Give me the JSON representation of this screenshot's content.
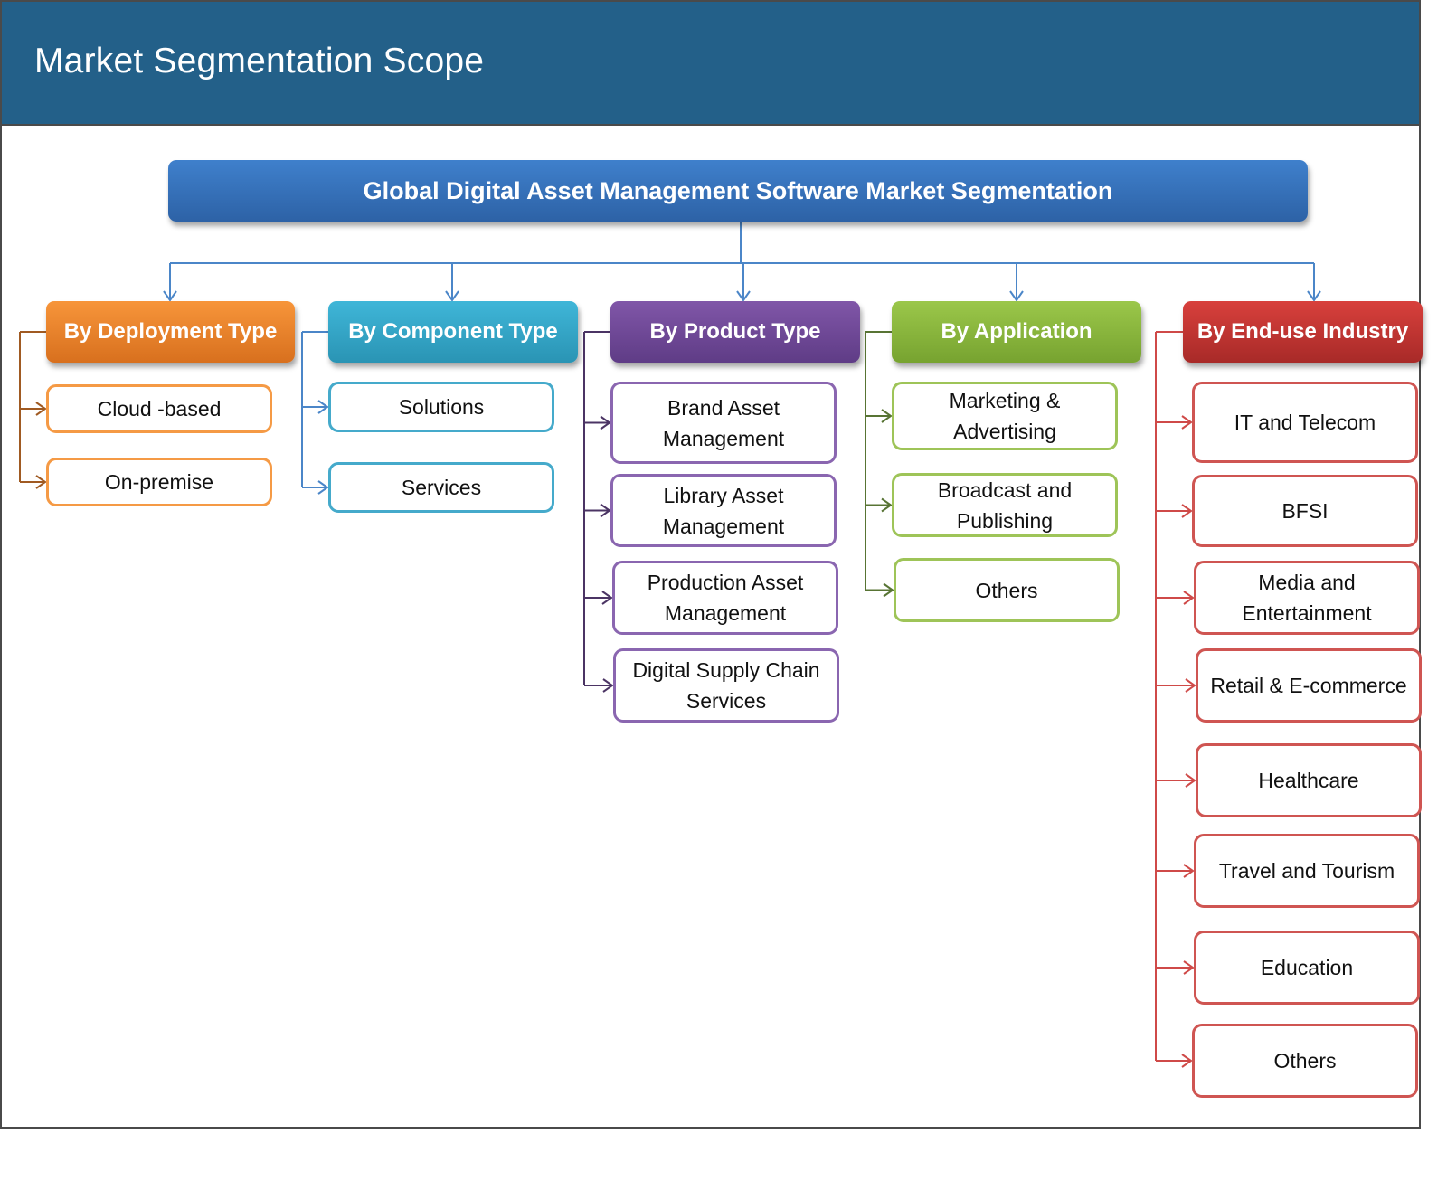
{
  "header": {
    "title": "Market Segmentation Scope"
  },
  "root": {
    "label": "Global Digital Asset Management Software Market Segmentation",
    "color": "#3a75c0"
  },
  "categories": [
    {
      "label": "By Deployment Type",
      "color_top": "#f7953a",
      "color_bottom": "#d8701e",
      "border": "#f59a45",
      "wire": "#a05a22",
      "items": [
        "Cloud -based",
        "On-premise"
      ]
    },
    {
      "label": "By Component Type",
      "color_top": "#3fb6d8",
      "color_bottom": "#2a94b4",
      "border": "#45aacb",
      "wire": "#4b86c8",
      "items": [
        "Solutions",
        "Services"
      ]
    },
    {
      "label": "By Product Type",
      "color_top": "#8056a8",
      "color_bottom": "#5f3c86",
      "border": "#8a66b0",
      "wire": "#4b3464",
      "items": [
        "Brand Asset Management",
        "Library Asset Management",
        "Production Asset Management",
        "Digital Supply Chain Services"
      ]
    },
    {
      "label": "By Application",
      "color_top": "#9bc74a",
      "color_bottom": "#77a330",
      "border": "#9ec458",
      "wire": "#587434",
      "items": [
        "Marketing & Advertising",
        "Broadcast and Publishing",
        "Others"
      ]
    },
    {
      "label": "By End-use Industry",
      "color_top": "#d8403c",
      "color_bottom": "#a82a28",
      "border": "#cf5552",
      "wire": "#cf4a48",
      "items": [
        "IT and Telecom",
        "BFSI",
        "Media and Entertainment",
        "Retail & E-commerce",
        "Healthcare",
        "Travel and Tourism",
        "Education",
        "Others"
      ]
    }
  ]
}
